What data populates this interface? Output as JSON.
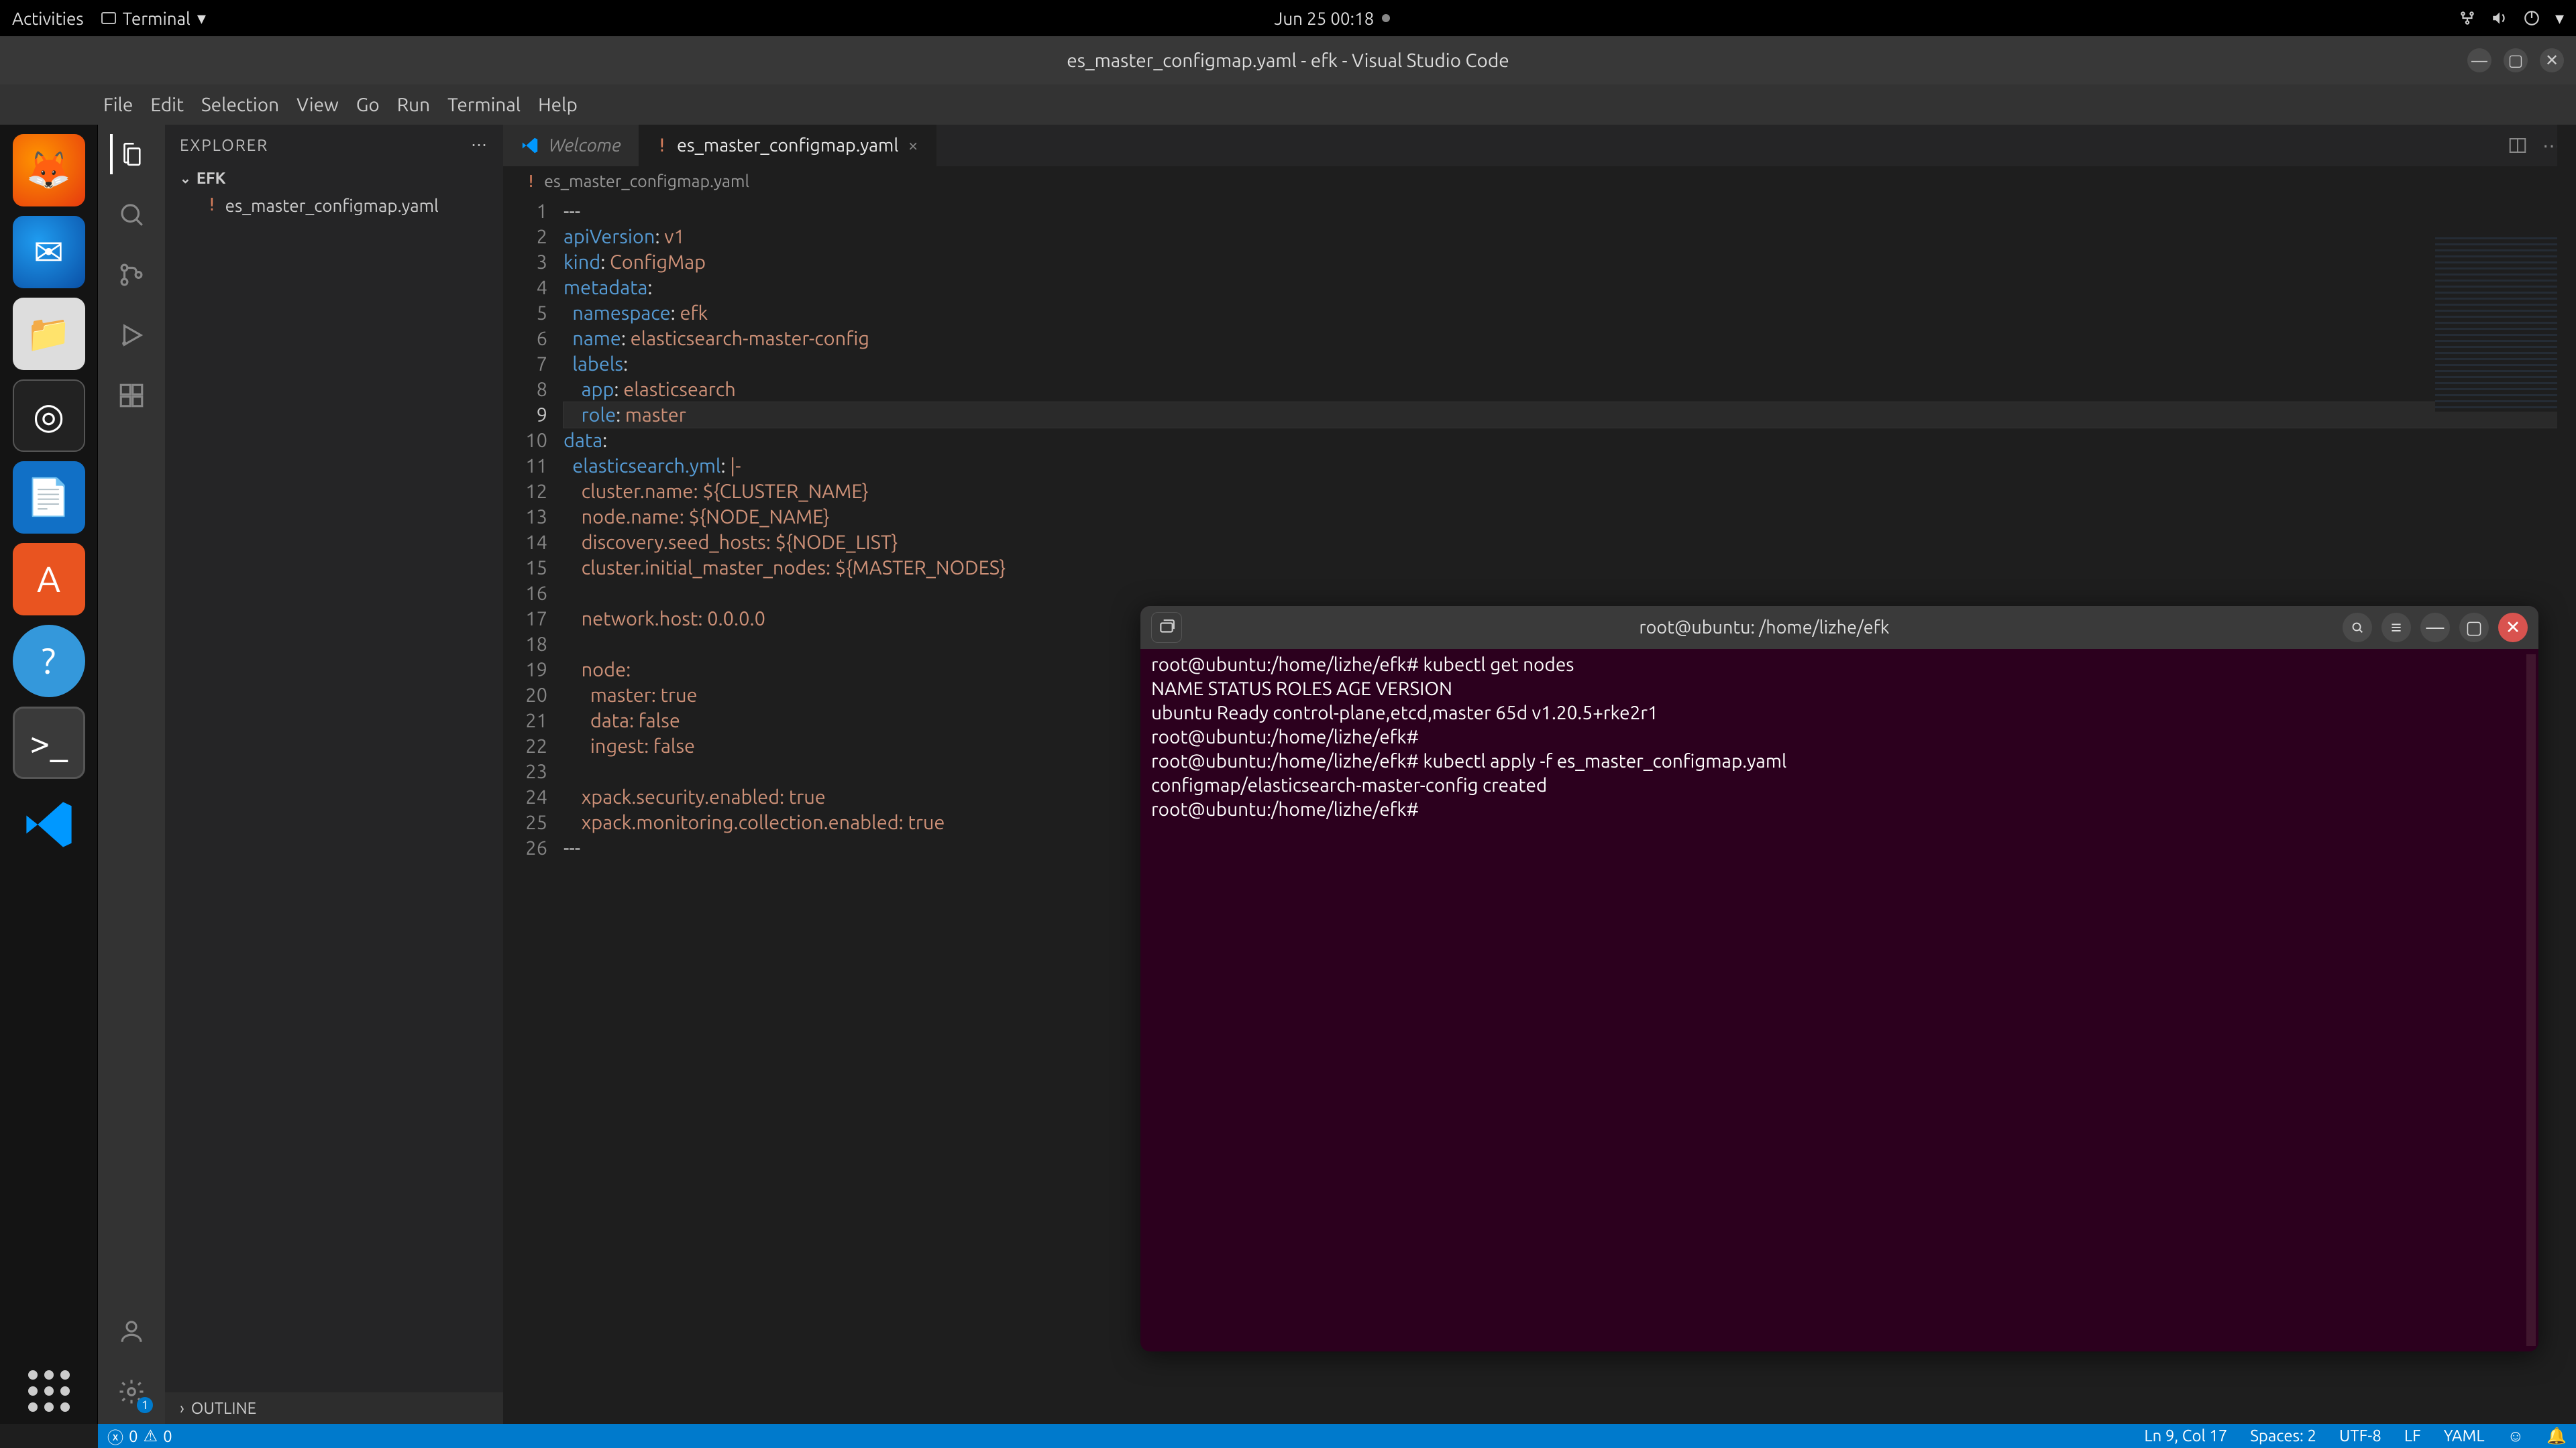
{
  "topbar": {
    "activities": "Activities",
    "terminal_label": "Terminal",
    "datetime": "Jun 25  00:18"
  },
  "window": {
    "title": "es_master_configmap.yaml - efk - Visual Studio Code"
  },
  "menubar": [
    "File",
    "Edit",
    "Selection",
    "View",
    "Go",
    "Run",
    "Terminal",
    "Help"
  ],
  "explorer": {
    "title": "EXPLORER",
    "folder": "EFK",
    "file": "es_master_configmap.yaml",
    "outline": "OUTLINE"
  },
  "tabs": {
    "welcome": "Welcome",
    "active": "es_master_configmap.yaml"
  },
  "breadcrumb": "es_master_configmap.yaml",
  "code_lines": [
    {
      "n": 1,
      "html": "<span class='p'>---</span>"
    },
    {
      "n": 2,
      "html": "<span class='k'>apiVersion</span><span class='p'>: </span><span class='s'>v1</span>"
    },
    {
      "n": 3,
      "html": "<span class='k'>kind</span><span class='p'>: </span><span class='s'>ConfigMap</span>"
    },
    {
      "n": 4,
      "html": "<span class='k'>metadata</span><span class='p'>:</span>"
    },
    {
      "n": 5,
      "html": "  <span class='k'>namespace</span><span class='p'>: </span><span class='s'>efk</span>"
    },
    {
      "n": 6,
      "html": "  <span class='k'>name</span><span class='p'>: </span><span class='s'>elasticsearch-master-config</span>"
    },
    {
      "n": 7,
      "html": "  <span class='k'>labels</span><span class='p'>:</span>"
    },
    {
      "n": 8,
      "html": "    <span class='k'>app</span><span class='p'>: </span><span class='s'>elasticsearch</span>"
    },
    {
      "n": 9,
      "html": "    <span class='k'>role</span><span class='p'>: </span><span class='s'>master</span>",
      "cur": true
    },
    {
      "n": 10,
      "html": "<span class='k'>data</span><span class='p'>:</span>"
    },
    {
      "n": 11,
      "html": "  <span class='k'>elasticsearch.yml</span><span class='p'>: </span><span class='s'>|-</span>"
    },
    {
      "n": 12,
      "html": "    <span class='s'>cluster.name: ${CLUSTER_NAME}</span>"
    },
    {
      "n": 13,
      "html": "    <span class='s'>node.name: ${NODE_NAME}</span>"
    },
    {
      "n": 14,
      "html": "    <span class='s'>discovery.seed_hosts: ${NODE_LIST}</span>"
    },
    {
      "n": 15,
      "html": "    <span class='s'>cluster.initial_master_nodes: ${MASTER_NODES}</span>"
    },
    {
      "n": 16,
      "html": ""
    },
    {
      "n": 17,
      "html": "    <span class='s'>network.host: 0.0.0.0</span>"
    },
    {
      "n": 18,
      "html": ""
    },
    {
      "n": 19,
      "html": "    <span class='s'>node:</span>"
    },
    {
      "n": 20,
      "html": "      <span class='s'>master: true</span>"
    },
    {
      "n": 21,
      "html": "      <span class='s'>data: false</span>"
    },
    {
      "n": 22,
      "html": "      <span class='s'>ingest: false</span>"
    },
    {
      "n": 23,
      "html": ""
    },
    {
      "n": 24,
      "html": "    <span class='s'>xpack.security.enabled: true</span>"
    },
    {
      "n": 25,
      "html": "    <span class='s'>xpack.monitoring.collection.enabled: true</span>"
    },
    {
      "n": 26,
      "html": "<span class='p'>---</span>"
    }
  ],
  "terminal": {
    "title": "root@ubuntu: /home/lizhe/efk",
    "lines": [
      "root@ubuntu:/home/lizhe/efk# kubectl get nodes",
      "NAME     STATUS   ROLES                       AGE   VERSION",
      "ubuntu   Ready    control-plane,etcd,master   65d   v1.20.5+rke2r1",
      "root@ubuntu:/home/lizhe/efk#",
      "root@ubuntu:/home/lizhe/efk# kubectl apply -f es_master_configmap.yaml",
      "configmap/elasticsearch-master-config created",
      "root@ubuntu:/home/lizhe/efk#"
    ]
  },
  "status": {
    "errors": "0",
    "warnings": "0",
    "position": "Ln 9, Col 17",
    "spaces": "Spaces: 2",
    "encoding": "UTF-8",
    "eol": "LF",
    "lang": "YAML"
  }
}
